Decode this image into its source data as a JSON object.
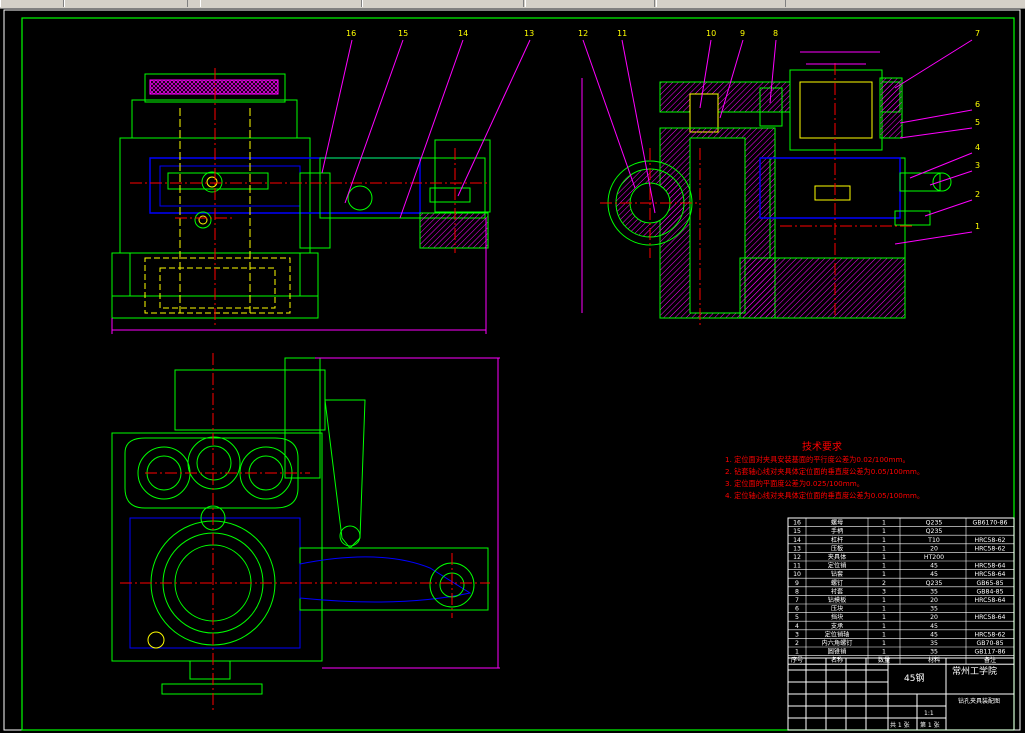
{
  "colors": {
    "green": "#00ff00",
    "yellow": "#ffff00",
    "red": "#ff0000",
    "blue": "#0000ff",
    "magenta": "#ff00ff",
    "white": "#ffffff",
    "cyan": "#00ffff"
  },
  "balloons": [
    "16",
    "15",
    "14",
    "13",
    "12",
    "11",
    "10",
    "9",
    "8",
    "7",
    "6",
    "5",
    "4",
    "3",
    "2",
    "1"
  ],
  "tech_title": "技术要求",
  "tech_requirements": [
    "1. 定位面对夹具安装基面的平行度公差为0.02/100mm。",
    "2. 钻套轴心线对夹具体定位面的垂直度公差为0.05/100mm。",
    "3. 定位面的平面度公差为0.025/100mm。",
    "4. 定位轴心线对夹具体定位面的垂直度公差为0.05/100mm。"
  ],
  "bom_rows": [
    {
      "no": "16",
      "name": "螺母",
      "qty": "1",
      "mat": "Q235",
      "std": "GB6170-86"
    },
    {
      "no": "15",
      "name": "手柄",
      "qty": "1",
      "mat": "Q235",
      "std": ""
    },
    {
      "no": "14",
      "name": "杠杆",
      "qty": "1",
      "mat": "T10",
      "std": "HRC58-62"
    },
    {
      "no": "13",
      "name": "压板",
      "qty": "1",
      "mat": "20",
      "std": "HRC58-62"
    },
    {
      "no": "12",
      "name": "夹具体",
      "qty": "1",
      "mat": "HT200",
      "std": ""
    },
    {
      "no": "11",
      "name": "定位销",
      "qty": "1",
      "mat": "45",
      "std": "HRC58-64"
    },
    {
      "no": "10",
      "name": "钻套",
      "qty": "1",
      "mat": "45",
      "std": "HRC58-64"
    },
    {
      "no": "9",
      "name": "螺钉",
      "qty": "2",
      "mat": "Q235",
      "std": "GB65-85"
    },
    {
      "no": "8",
      "name": "衬套",
      "qty": "3",
      "mat": "35",
      "std": "GB84-85"
    },
    {
      "no": "7",
      "name": "钻模板",
      "qty": "1",
      "mat": "20",
      "std": "HRC58-64"
    },
    {
      "no": "6",
      "name": "压块",
      "qty": "1",
      "mat": "35",
      "std": ""
    },
    {
      "no": "5",
      "name": "挡块",
      "qty": "1",
      "mat": "20",
      "std": "HRC58-64"
    },
    {
      "no": "4",
      "name": "支承",
      "qty": "1",
      "mat": "45",
      "std": ""
    },
    {
      "no": "3",
      "name": "定位销轴",
      "qty": "1",
      "mat": "45",
      "std": "HRC58-62"
    },
    {
      "no": "2",
      "name": "内六角螺钉",
      "qty": "1",
      "mat": "35",
      "std": "GB70-85"
    },
    {
      "no": "1",
      "name": "圆锥销",
      "qty": "1",
      "mat": "35",
      "std": "GB117-86"
    }
  ],
  "bom_header": [
    "序号",
    "名称",
    "数量",
    "材料",
    "备注"
  ],
  "title_block": {
    "material": "45钢",
    "school": "常州工学院",
    "drawing_name": "钻孔夹具装配图",
    "scale": "1:1",
    "sheet_total": "共 1 张",
    "sheet_no": "第 1 张"
  }
}
